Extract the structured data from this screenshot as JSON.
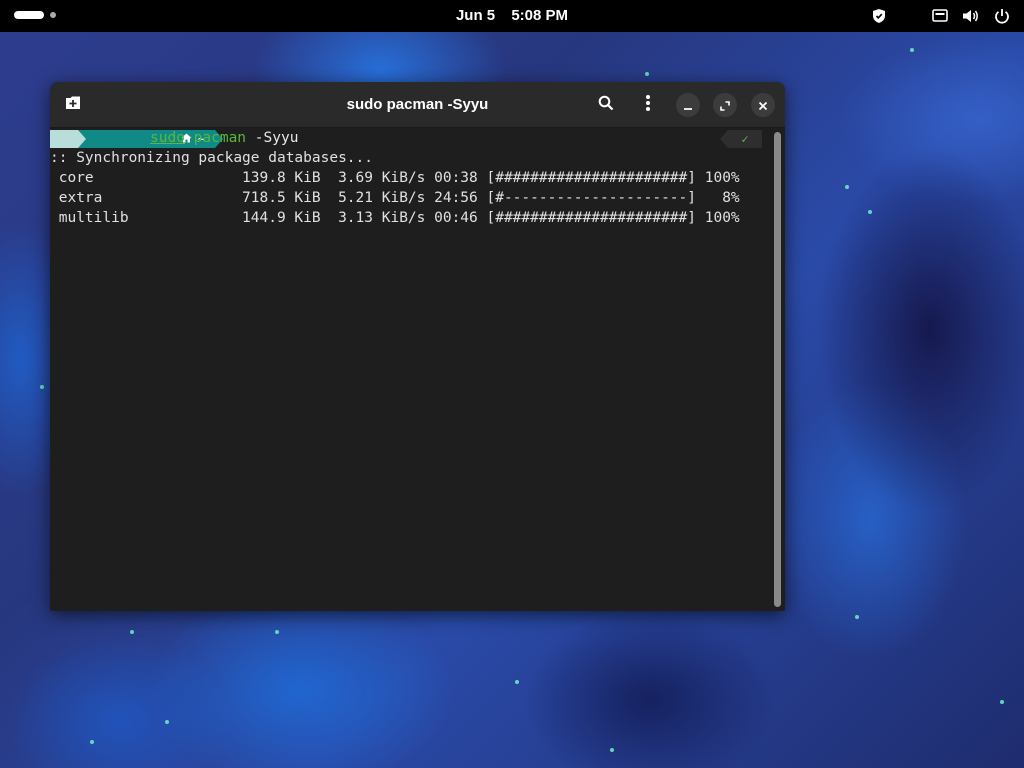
{
  "topbar": {
    "date": "Jun 5",
    "time": "5:08 PM"
  },
  "window": {
    "title": "sudo pacman -Syyu"
  },
  "terminal": {
    "prompt": {
      "home_symbol": "~",
      "cmd_sudo": "sudo",
      "cmd_pacman": "pacman",
      "cmd_args": "-Syyu",
      "status": "✓"
    },
    "lines": [
      ":: Synchronizing package databases...",
      " core                 139.8 KiB  3.69 KiB/s 00:38 [######################] 100%",
      " extra                718.5 KiB  5.21 KiB/s 24:56 [#---------------------]   8%",
      " multilib             144.9 KiB  3.13 KiB/s 00:46 [######################] 100%"
    ]
  },
  "colors": {
    "prompt_green": "#5bb73e",
    "segment_teal": "#0f8a86",
    "terminal_bg": "#1e1e1e"
  },
  "icons": {
    "titlebar": [
      "new-tab-icon",
      "search-icon",
      "menu-icon",
      "minimize-icon",
      "maximize-icon",
      "close-icon"
    ],
    "tray": [
      "shield-icon",
      "network-icon",
      "volume-icon",
      "power-icon"
    ]
  }
}
